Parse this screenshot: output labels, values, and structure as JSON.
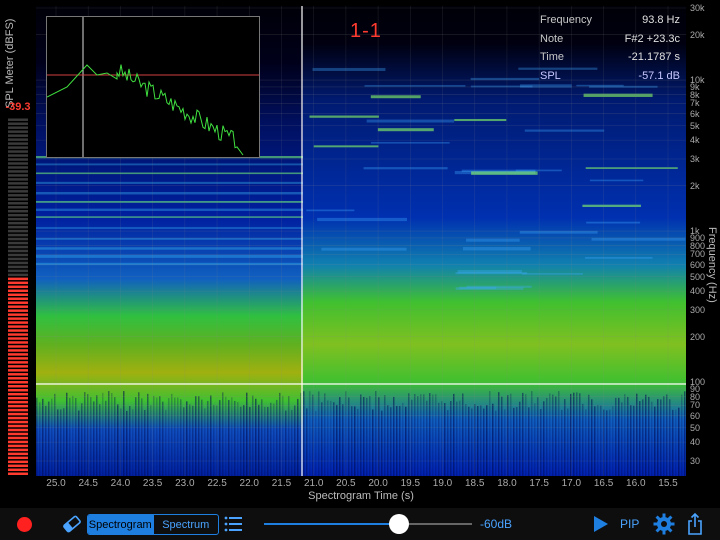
{
  "meter": {
    "title": "SPL Meter (dBFS)",
    "value": "-39.3",
    "level": 0.56
  },
  "marker": "1-1",
  "readout": [
    {
      "key": "Frequency",
      "value": "93.8 Hz"
    },
    {
      "key": "Note",
      "value": "F#2 +23.3c"
    },
    {
      "key": "Time",
      "value": "-21.1787 s"
    },
    {
      "key": "SPL",
      "value": "-57.1 dB"
    }
  ],
  "yaxis": {
    "label": "Frequency (Hz)",
    "ticks": [
      "30k",
      "20k",
      "10k",
      "9k",
      "8k",
      "7k",
      "6k",
      "5k",
      "4k",
      "3k",
      "2k",
      "1k",
      "900",
      "800",
      "700",
      "600",
      "500",
      "400",
      "300",
      "200",
      "100",
      "90",
      "80",
      "70",
      "60",
      "50",
      "40",
      "30"
    ]
  },
  "xaxis": {
    "label": "Spectrogram Time (s)",
    "ticks": [
      "25.0",
      "24.5",
      "24.0",
      "23.5",
      "23.0",
      "22.5",
      "22.0",
      "21.5",
      "21.0",
      "20.5",
      "20.0",
      "19.5",
      "19.0",
      "18.5",
      "18.0",
      "17.5",
      "17.0",
      "16.5",
      "16.0",
      "15.5"
    ]
  },
  "colors": {
    "accent": "#1e7fe0",
    "record": "#ff2020",
    "meter_on": "#ff3b30"
  },
  "toolbar": {
    "record_icon": "record-icon",
    "eraser_icon": "eraser-icon",
    "tab_spectrogram": "Spectrogram",
    "tab_spectrum": "Spectrum",
    "list_icon": "list-icon",
    "gain_value": 0.65,
    "gain_label": "-60dB",
    "play_icon": "play-icon",
    "pip_label": "PIP",
    "gear_icon": "gear-icon",
    "share_icon": "share-icon"
  }
}
